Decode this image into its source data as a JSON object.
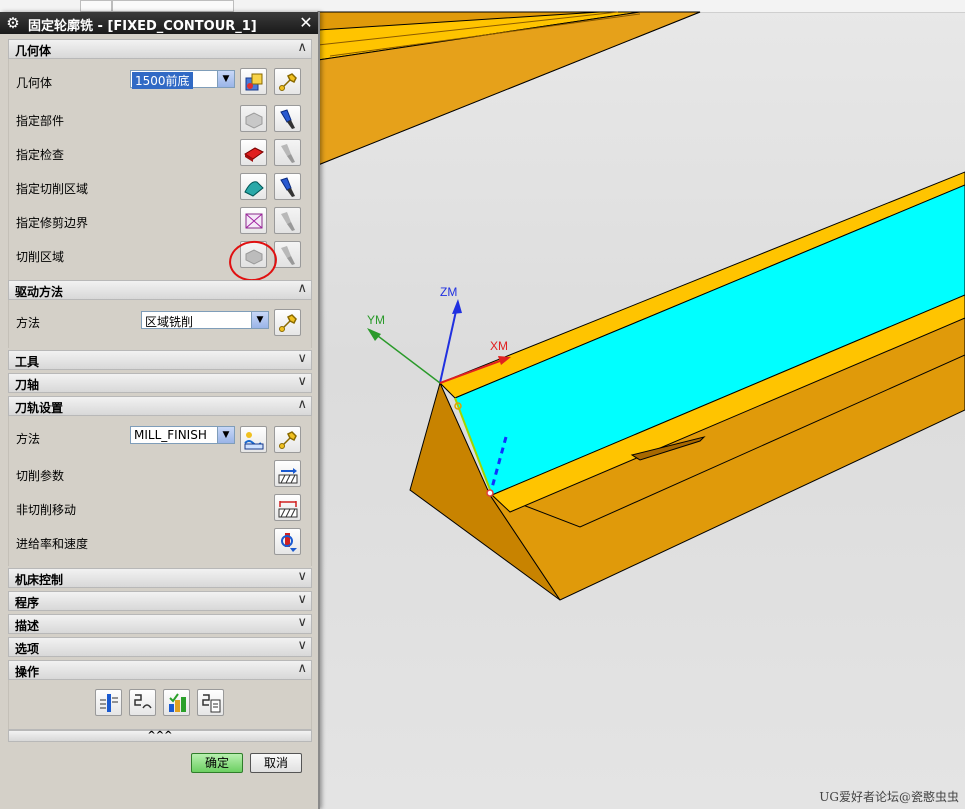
{
  "dialog": {
    "title": "固定轮廓铣 - [FIXED_CONTOUR_1]",
    "ok_label": "确定",
    "cancel_label": "取消",
    "expand_glyph": "^^^"
  },
  "sections": {
    "geometry": {
      "title": "几何体",
      "geometry_label": "几何体",
      "geometry_value": "1500前底",
      "part_label": "指定部件",
      "check_label": "指定检查",
      "cut_area_label": "指定切削区域",
      "trim_boundary_label": "指定修剪边界",
      "cut_region_label": "切削区域"
    },
    "drive": {
      "title": "驱动方法",
      "method_label": "方法",
      "method_value": "区域铣削"
    },
    "tool": {
      "title": "工具"
    },
    "tool_axis": {
      "title": "刀轴"
    },
    "path_settings": {
      "title": "刀轨设置",
      "method_label": "方法",
      "method_value": "MILL_FINISH",
      "cut_params_label": "切削参数",
      "non_cut_label": "非切削移动",
      "feeds_label": "进给率和速度"
    },
    "machine_control": {
      "title": "机床控制"
    },
    "program": {
      "title": "程序"
    },
    "description": {
      "title": "描述"
    },
    "options": {
      "title": "选项"
    },
    "actions": {
      "title": "操作"
    }
  },
  "viewport": {
    "axis_zm": "ZM",
    "axis_ym": "YM",
    "axis_xm": "XM",
    "watermark": "UG爱好者论坛@瓷憨虫虫",
    "colors": {
      "body": "#e09a0a",
      "body_dark": "#a76800",
      "rim": "#ffc400",
      "cut_area": "#00ffff",
      "background": "#e0e0e0"
    }
  },
  "icons": {
    "gear": "gear-icon",
    "close": "close-icon",
    "chevron_up": "chevron-up-icon",
    "chevron_down": "chevron-down-icon",
    "wrench": "wrench-icon",
    "flashlight": "flashlight-icon"
  }
}
